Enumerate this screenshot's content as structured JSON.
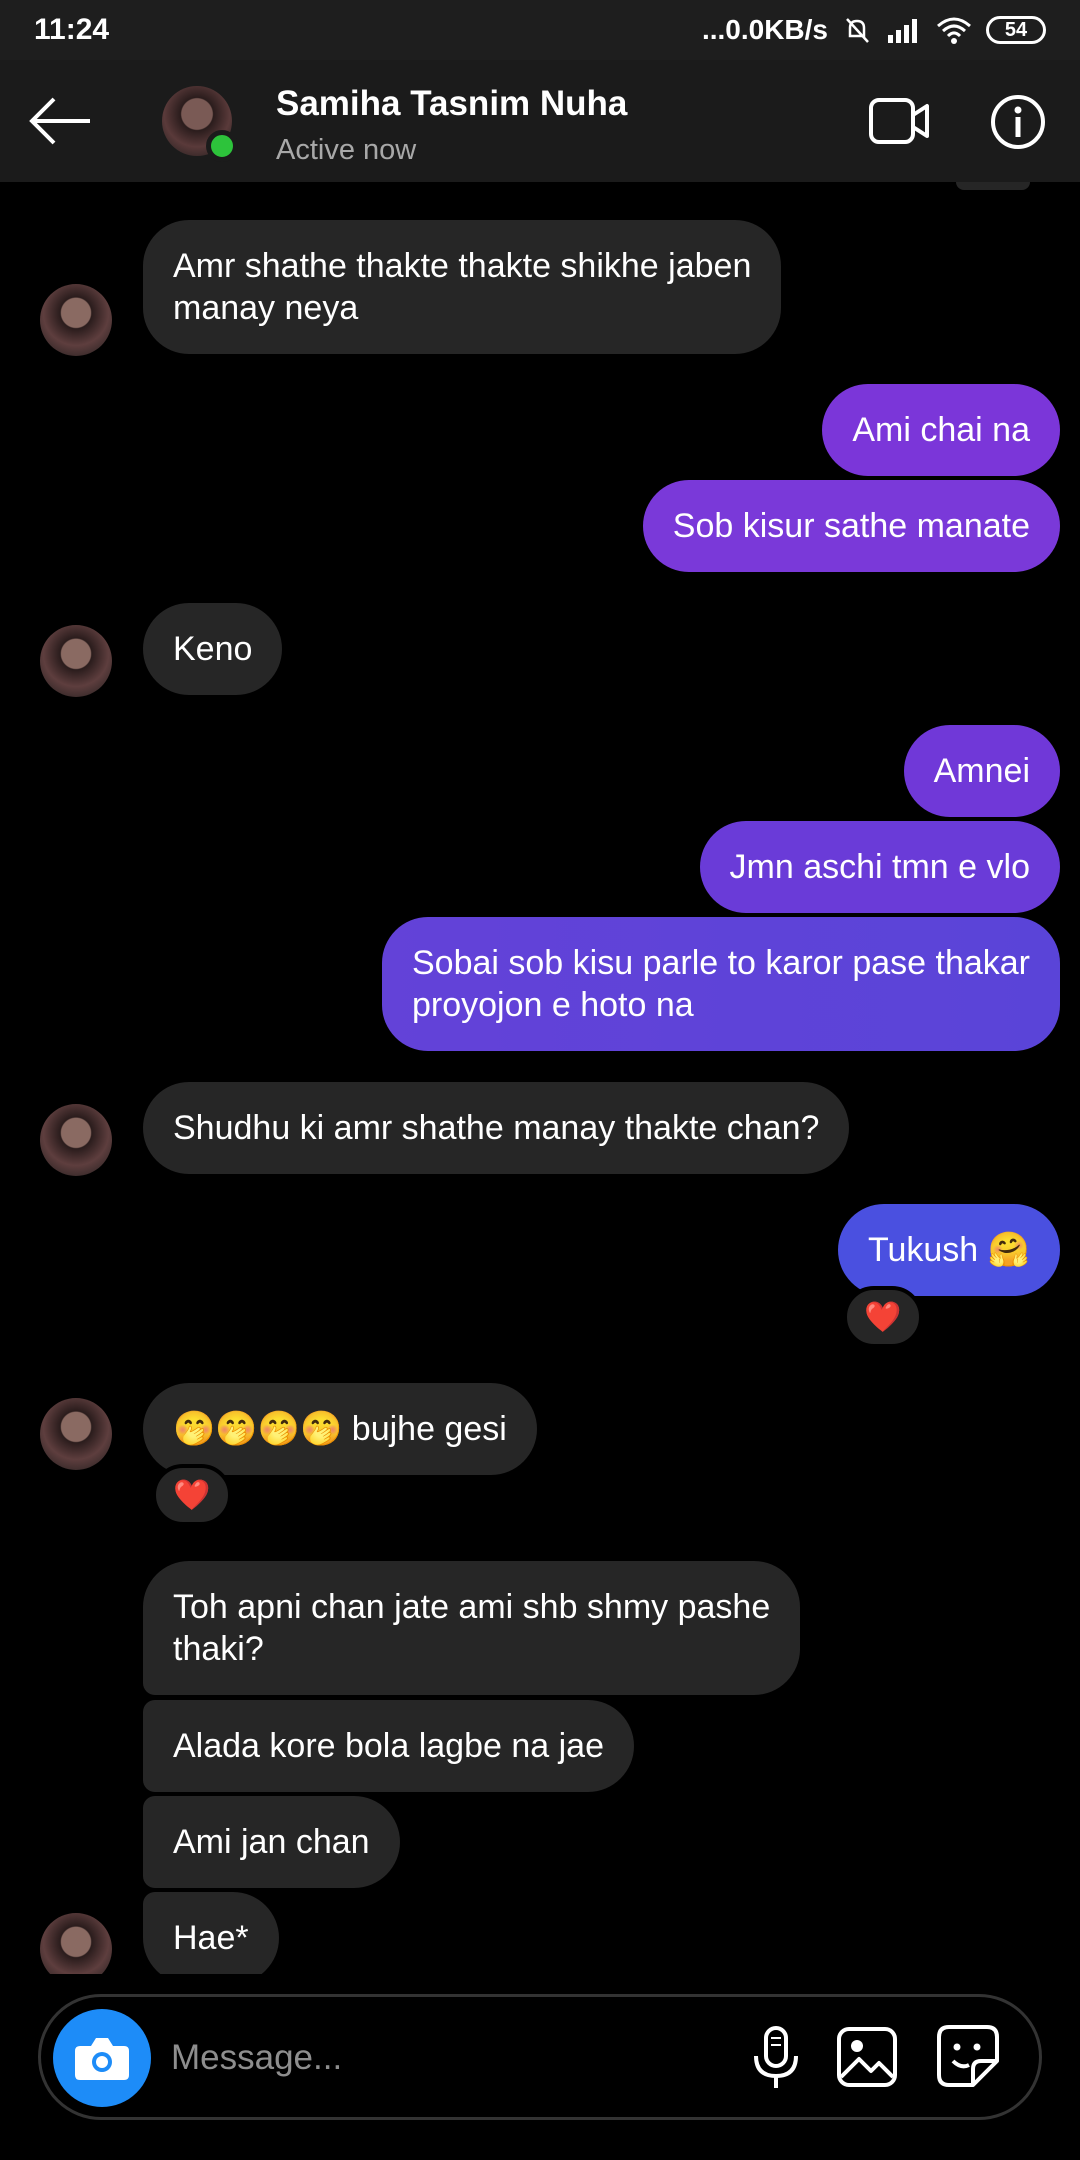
{
  "status_bar": {
    "time": "11:24",
    "network_speed": "...0.0KB/s",
    "battery": "54"
  },
  "header": {
    "contact_name": "Samiha Tasnim Nuha",
    "contact_status": "Active now"
  },
  "messages": [
    {
      "side": "in",
      "text": "Amr shathe thakte thakte shikhe jaben\nmanay neya"
    },
    {
      "side": "out",
      "text": "Ami chai na"
    },
    {
      "side": "out",
      "text": "Sob kisur sathe manate"
    },
    {
      "side": "in",
      "text": "Keno"
    },
    {
      "side": "out",
      "text": "Amnei"
    },
    {
      "side": "out",
      "text": "Jmn aschi tmn e vlo"
    },
    {
      "side": "out",
      "text": "Sobai sob kisu parle to karor pase thakar\nproyojon e hoto na"
    },
    {
      "side": "in",
      "text": "Shudhu ki amr shathe manay thakte chan?"
    },
    {
      "side": "out",
      "text": "Tukush 🤗",
      "reaction": "❤️"
    },
    {
      "side": "in",
      "text": "🤭🤭🤭🤭 bujhe gesi",
      "reaction": "❤️"
    },
    {
      "side": "in",
      "text": "Toh apni chan jate ami shb shmy pashe\nthaki?"
    },
    {
      "side": "in",
      "text": "Alada kore bola lagbe na jae"
    },
    {
      "side": "in",
      "text": "Ami jan chan"
    },
    {
      "side": "in",
      "text": "Hae*"
    }
  ],
  "composer": {
    "placeholder": "Message..."
  },
  "colors": {
    "incoming_bubble": "#262626",
    "outgoing_purple": "#7b36d9",
    "outgoing_indigo": "#5a44d8",
    "outgoing_blue": "#4a50e0",
    "camera_blue": "#1d8cf8",
    "online_green": "#2dc33b"
  }
}
